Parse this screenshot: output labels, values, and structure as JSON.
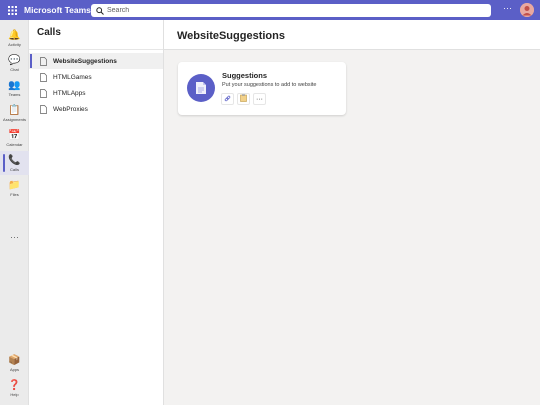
{
  "app": {
    "title": "Microsoft Teams"
  },
  "search": {
    "placeholder": "Search"
  },
  "topbar": {
    "more_label": "···"
  },
  "rail": {
    "items": [
      {
        "label": "Activity",
        "icon": "bell-icon",
        "glyph": "🔔"
      },
      {
        "label": "Chat",
        "icon": "chat-icon",
        "glyph": "💬"
      },
      {
        "label": "Teams",
        "icon": "teams-icon",
        "glyph": "👥"
      },
      {
        "label": "Assignments",
        "icon": "assignments-icon",
        "glyph": "📋"
      },
      {
        "label": "Calendar",
        "icon": "calendar-icon",
        "glyph": "📅"
      },
      {
        "label": "Calls",
        "icon": "phone-icon",
        "glyph": "📞"
      },
      {
        "label": "Files",
        "icon": "folder-icon",
        "glyph": "📁"
      }
    ],
    "more_label": "···",
    "apps": {
      "label": "Apps",
      "icon": "apps-icon",
      "glyph": "📦"
    },
    "help": {
      "label": "Help",
      "icon": "help-icon",
      "glyph": "❓"
    }
  },
  "channels": {
    "header": "Calls",
    "items": [
      {
        "label": "WebsiteSuggestions"
      },
      {
        "label": "HTMLGames"
      },
      {
        "label": "HTMLApps"
      },
      {
        "label": "WebProxies"
      }
    ]
  },
  "main": {
    "title": "WebsiteSuggestions",
    "card": {
      "title": "Suggestions",
      "description": "Put your suggestions to add to website",
      "actions": {
        "more_label": "···"
      }
    }
  },
  "colors": {
    "accent": "#5b5fc7",
    "rail_bg": "#ebebeb"
  }
}
